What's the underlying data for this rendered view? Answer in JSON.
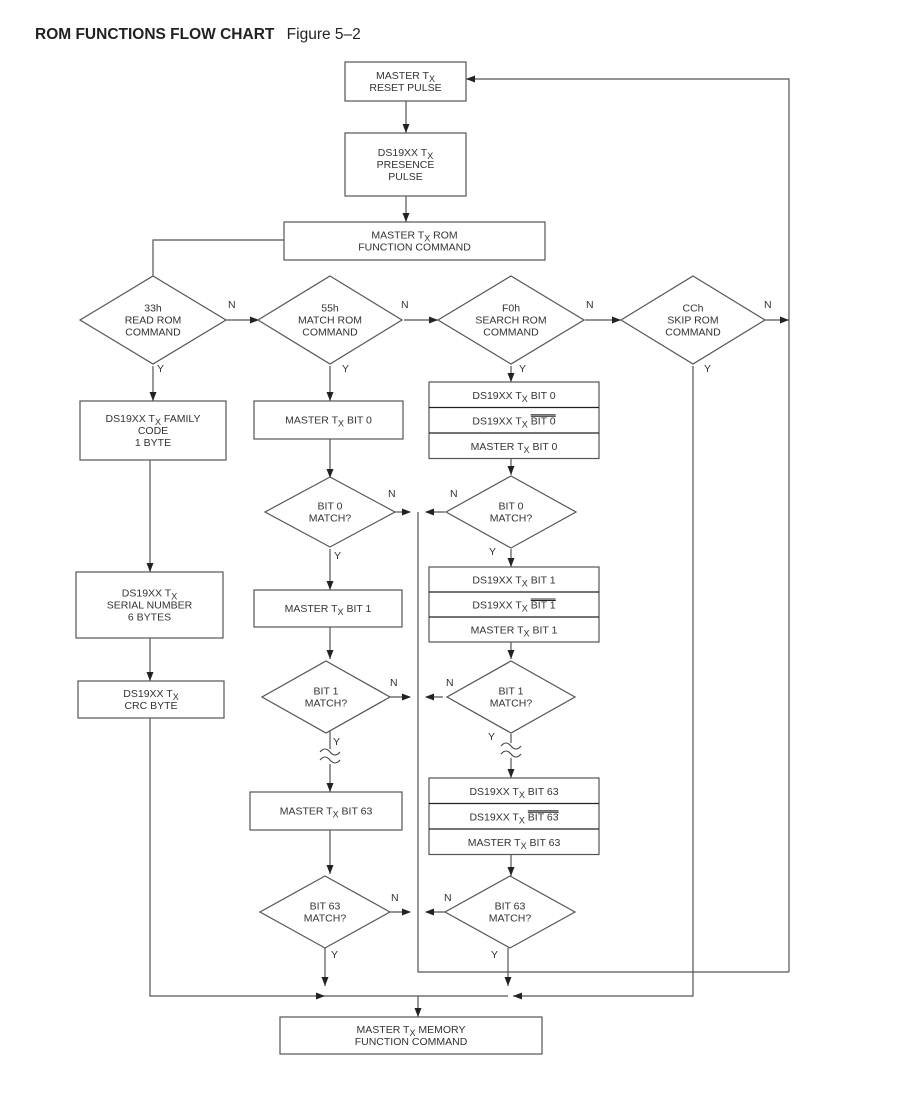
{
  "title": {
    "main": "ROM FUNCTIONS FLOW CHART",
    "figure": "Figure 5–2"
  },
  "branch_labels": {
    "yes": "Y",
    "no": "N"
  },
  "nodes": {
    "reset": {
      "lines": [
        "MASTER T|X",
        "RESET PULSE"
      ]
    },
    "presence": {
      "lines": [
        "DS19XX T|X",
        "PRESENCE",
        "PULSE"
      ]
    },
    "rom_cmd": {
      "lines": [
        "MASTER T|X| ROM",
        "FUNCTION COMMAND"
      ]
    },
    "read_rom": {
      "lines": [
        "33h",
        "READ ROM",
        "COMMAND"
      ]
    },
    "match_rom": {
      "lines": [
        "55h",
        "MATCH ROM",
        "COMMAND"
      ]
    },
    "search_rom": {
      "lines": [
        "F0h",
        "SEARCH ROM",
        "COMMAND"
      ]
    },
    "skip_rom": {
      "lines": [
        "CCh",
        "SKIP ROM",
        "COMMAND"
      ]
    },
    "family_code": {
      "lines": [
        "DS19XX T|X| FAMILY",
        "CODE",
        "1 BYTE"
      ]
    },
    "serial_number": {
      "lines": [
        "DS19XX T|X",
        "SERIAL NUMBER",
        "6 BYTES"
      ]
    },
    "crc_byte": {
      "lines": [
        "DS19XX T|X",
        "CRC BYTE"
      ]
    },
    "m_bit0": {
      "lines": [
        "MASTER T|X| BIT 0"
      ]
    },
    "m_bit1": {
      "lines": [
        "MASTER T|X| BIT 1"
      ]
    },
    "m_bit63": {
      "lines": [
        "MASTER T|X| BIT 63"
      ]
    },
    "m_match0": {
      "lines": [
        "BIT 0",
        "MATCH?"
      ]
    },
    "m_match1": {
      "lines": [
        "BIT 1",
        "MATCH?"
      ]
    },
    "m_match63": {
      "lines": [
        "BIT 63",
        "MATCH?"
      ]
    },
    "s_bit0": {
      "rows": [
        "DS19XX T|X| BIT 0",
        "DS19XX T|X| ~BIT 0",
        "MASTER T|X| BIT 0"
      ]
    },
    "s_bit1": {
      "rows": [
        "DS19XX T|X| BIT 1",
        "DS19XX T|X| ~BIT 1",
        "MASTER T|X| BIT 1"
      ]
    },
    "s_bit63": {
      "rows": [
        "DS19XX T|X| BIT 63",
        "DS19XX T|X| ~BIT 63",
        "MASTER T|X| BIT 63"
      ]
    },
    "s_match0": {
      "lines": [
        "BIT 0",
        "MATCH?"
      ]
    },
    "s_match1": {
      "lines": [
        "BIT 1",
        "MATCH?"
      ]
    },
    "s_match63": {
      "lines": [
        "BIT 63",
        "MATCH?"
      ]
    },
    "memory_cmd": {
      "lines": [
        "MASTER T|X| MEMORY",
        "FUNCTION COMMAND"
      ]
    }
  }
}
